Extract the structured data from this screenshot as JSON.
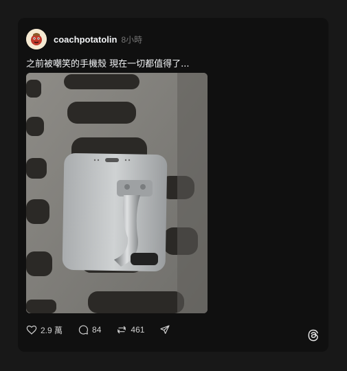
{
  "post": {
    "username": "coachpotatolin",
    "time": "8小時",
    "caption": "之前被嘲笑的手機殼 現在一切都值得了..."
  },
  "actions": {
    "likes": "2.9 萬",
    "comments": "84",
    "reposts": "461"
  },
  "icons": {
    "like": "heart-icon",
    "comment": "comment-icon",
    "repost": "repost-icon",
    "share": "send-icon",
    "brand": "threads-logo"
  },
  "colors": {
    "page_bg": "#181818",
    "card_bg": "#101010",
    "text": "#f3f5f7",
    "muted": "#777777"
  }
}
